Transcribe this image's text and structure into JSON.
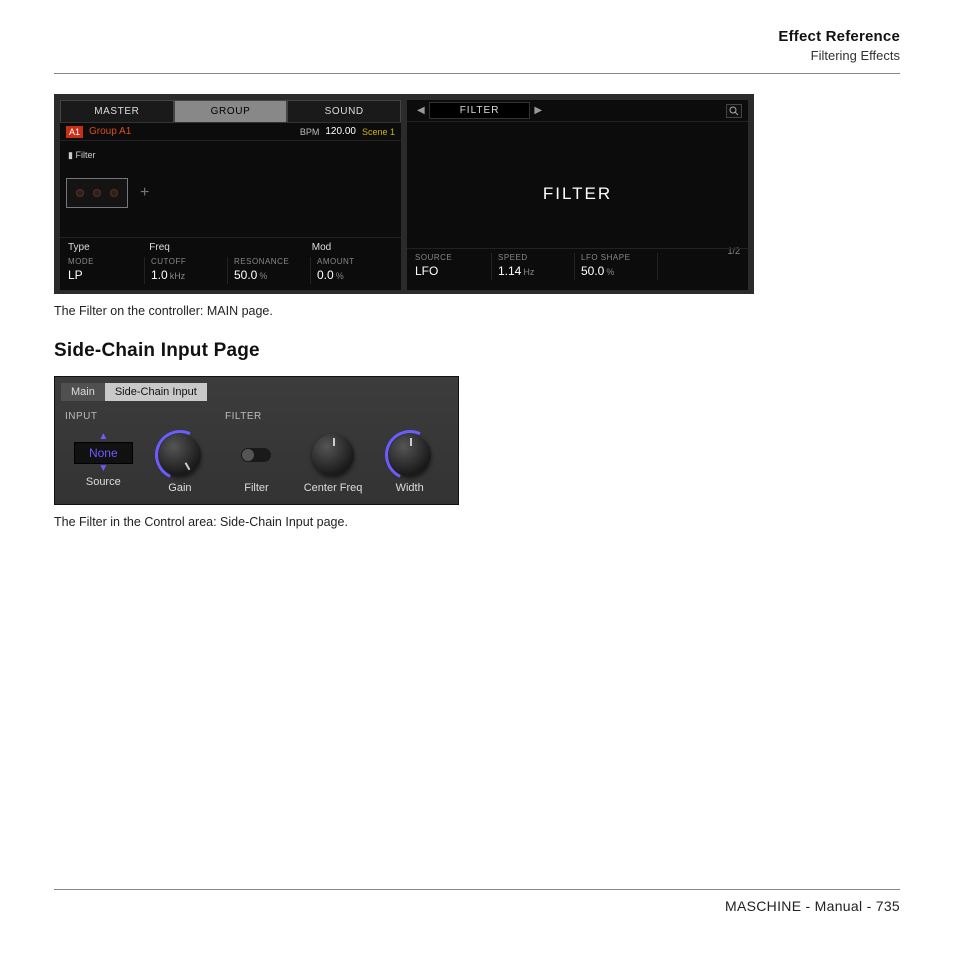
{
  "header": {
    "title": "Effect Reference",
    "subtitle": "Filtering Effects"
  },
  "controller": {
    "tabs": [
      "MASTER",
      "GROUP",
      "SOUND"
    ],
    "active_tab_index": 1,
    "group_badge": "A1",
    "group_name": "Group A1",
    "bpm_label": "BPM",
    "bpm_value": "120.00",
    "scene": "Scene 1",
    "slot_label": "Filter",
    "headers": {
      "type": "Type",
      "freq": "Freq",
      "mod": "Mod"
    },
    "left_params": [
      {
        "label": "MODE",
        "value": "LP",
        "unit": ""
      },
      {
        "label": "CUTOFF",
        "value": "1.0",
        "unit": "kHz"
      },
      {
        "label": "RESONANCE",
        "value": "50.0",
        "unit": "%"
      },
      {
        "label": "AMOUNT",
        "value": "0.0",
        "unit": "%"
      }
    ],
    "right_title_bar": "FILTER",
    "big_title": "FILTER",
    "page_indicator": "1/2",
    "right_params": [
      {
        "label": "SOURCE",
        "value": "LFO",
        "unit": ""
      },
      {
        "label": "SPEED",
        "value": "1.14",
        "unit": "Hz"
      },
      {
        "label": "LFO SHAPE",
        "value": "50.0",
        "unit": "%"
      },
      {
        "label": "",
        "value": "",
        "unit": ""
      }
    ]
  },
  "caption1": "The Filter on the controller: MAIN page.",
  "section_heading": "Side-Chain Input Page",
  "sidechain": {
    "tabs": [
      "Main",
      "Side-Chain Input"
    ],
    "active_tab_index": 1,
    "section_input": "INPUT",
    "section_filter": "FILTER",
    "none_value": "None",
    "controls": [
      {
        "label": "Source"
      },
      {
        "label": "Gain"
      },
      {
        "label": "Filter"
      },
      {
        "label": "Center Freq"
      },
      {
        "label": "Width"
      }
    ]
  },
  "caption2": "The Filter in the Control area: Side-Chain Input page.",
  "footer": "MASCHINE - Manual - 735"
}
